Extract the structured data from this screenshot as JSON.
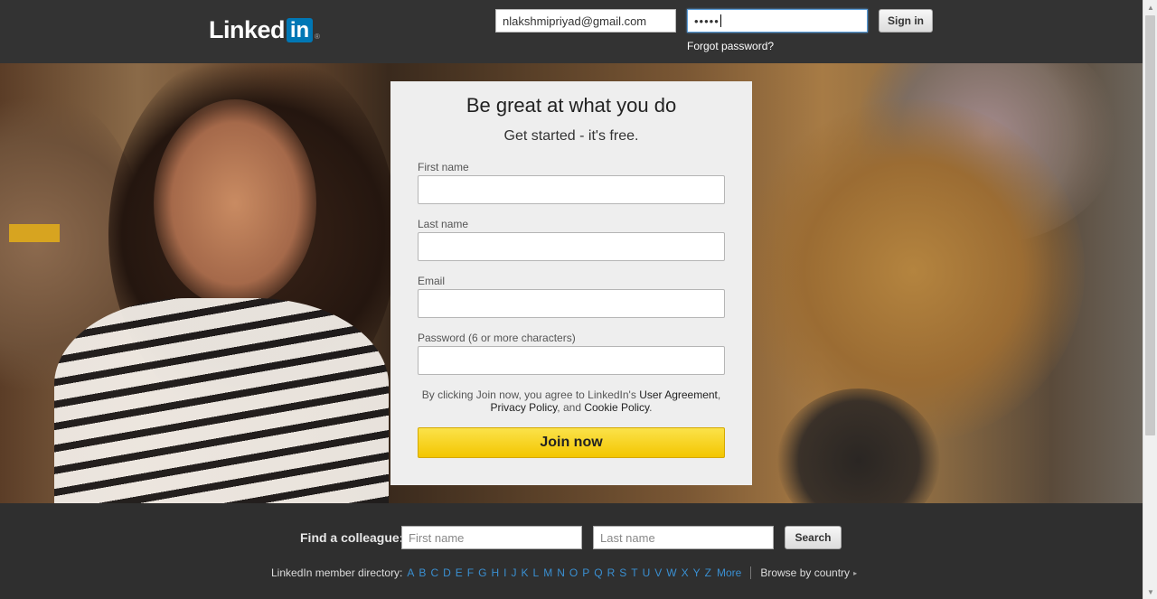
{
  "header": {
    "logo_text": "Linked",
    "logo_box": "in",
    "logo_reg": "®",
    "email_value": "nlakshmipriyad@gmail.com",
    "password_mask": "•••••",
    "signin_label": "Sign in",
    "forgot_label": "Forgot password?"
  },
  "signup": {
    "title": "Be great at what you do",
    "subtitle": "Get started - it's free.",
    "first_name_label": "First name",
    "last_name_label": "Last name",
    "email_label": "Email",
    "password_label": "Password (6 or more characters)",
    "terms_prefix": "By clicking Join now, you agree to LinkedIn's ",
    "user_agreement": "User Agreement",
    "terms_comma": ",",
    "privacy_policy": "Privacy Policy",
    "terms_and": ", and ",
    "cookie_policy": "Cookie Policy",
    "terms_period": ".",
    "join_label": "Join now"
  },
  "footer": {
    "find_label": "Find a colleague:",
    "first_placeholder": "First name",
    "last_placeholder": "Last name",
    "search_label": "Search",
    "directory_label": "LinkedIn member directory:",
    "letters": [
      "A",
      "B",
      "C",
      "D",
      "E",
      "F",
      "G",
      "H",
      "I",
      "J",
      "K",
      "L",
      "M",
      "N",
      "O",
      "P",
      "Q",
      "R",
      "S",
      "T",
      "U",
      "V",
      "W",
      "X",
      "Y",
      "Z"
    ],
    "more_label": "More",
    "browse_label": "Browse by country",
    "browse_arrow": "▸"
  },
  "colors": {
    "brand_blue": "#0077b5",
    "join_yellow": "#f5c800",
    "link_blue": "#3a8fd1",
    "dark_bg": "#333333"
  }
}
